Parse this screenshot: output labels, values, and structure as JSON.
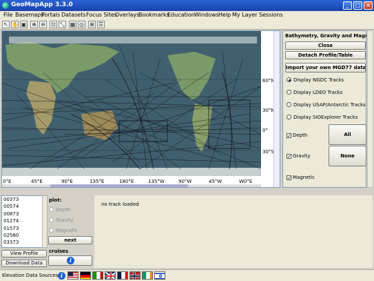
{
  "window": {
    "title": "GeoMapApp 3.3.0",
    "minimize": "_",
    "maximize": "□",
    "close": "×"
  },
  "menu": [
    "File",
    "Basemaps",
    "Portals",
    "Datasets",
    "Focus Sites",
    "Overlays",
    "Bookmarks",
    "Education",
    "Windows",
    "Help",
    "My Layer Sessions"
  ],
  "toolbar": {
    "tools": [
      {
        "name": "select-arrow-icon",
        "glyph": "↖"
      },
      {
        "name": "pan-hand-icon",
        "glyph": "✋"
      },
      {
        "name": "save-icon",
        "glyph": "▣"
      },
      {
        "name": "zoom-in-icon",
        "glyph": "⊕"
      },
      {
        "name": "zoom-out-icon",
        "glyph": "⊖"
      },
      {
        "name": "distance-profile-icon",
        "glyph": "⊡"
      },
      {
        "name": "digitize-icon",
        "glyph": "⤡"
      },
      {
        "name": "grid-icon",
        "glyph": "▦"
      },
      {
        "name": "contour-icon",
        "glyph": "◎"
      },
      {
        "name": "layers-grid-icon",
        "glyph": "⊞"
      },
      {
        "name": "layer-manager-icon",
        "glyph": "☰"
      }
    ]
  },
  "map": {
    "lat_labels": [
      "60°N",
      "30°N",
      "0°",
      "30°S"
    ],
    "lon_labels": [
      "0°E",
      "45°E",
      "90°E",
      "135°E",
      "180°E",
      "135°W",
      "90°W",
      "45°W",
      "W0°E"
    ]
  },
  "panel": {
    "title": "Bathymetry, Gravity and Magnetic P...",
    "close_label": "Close",
    "detach_label": "Detach Profile/Table",
    "import_label": "Import your own MGD77 data file(s)",
    "radios": [
      {
        "label": "Display NGDC Tracks",
        "selected": true
      },
      {
        "label": "Display LDEO Tracks",
        "selected": false
      },
      {
        "label": "Display USAP/Antarctic Tracks",
        "selected": false
      },
      {
        "label": "Display SIOExplorer Tracks",
        "selected": false
      }
    ],
    "checks": [
      {
        "label": "Depth",
        "checked": true
      },
      {
        "label": "Gravity",
        "checked": true
      },
      {
        "label": "Magnetic",
        "checked": true
      }
    ],
    "all_label": "All",
    "none_label": "None"
  },
  "cruises": {
    "items": [
      "00373",
      "00574",
      "00873",
      "01274",
      "01573",
      "02580",
      "03373",
      "03572"
    ],
    "view_profile_label": "View Profile",
    "download_label": "Download Data"
  },
  "plot": {
    "label": "plot:",
    "options": [
      "Depth",
      "Gravity",
      "Magnetic"
    ],
    "next_label": "next",
    "cruises_label": "cruises",
    "info_glyph": "i"
  },
  "track": {
    "message": "no track loaded"
  },
  "status": {
    "label": "Elevation Data Sources",
    "info_glyph": "i",
    "flags": [
      "USA",
      "Germany",
      "Italy",
      "UK",
      "France",
      "Norway",
      "Ireland",
      "Israel"
    ]
  },
  "colors": {
    "titlebar": "#245edb",
    "ocean": "#3d5a6e",
    "land": "#7b9a6a",
    "tracks": "#0b0b14"
  }
}
